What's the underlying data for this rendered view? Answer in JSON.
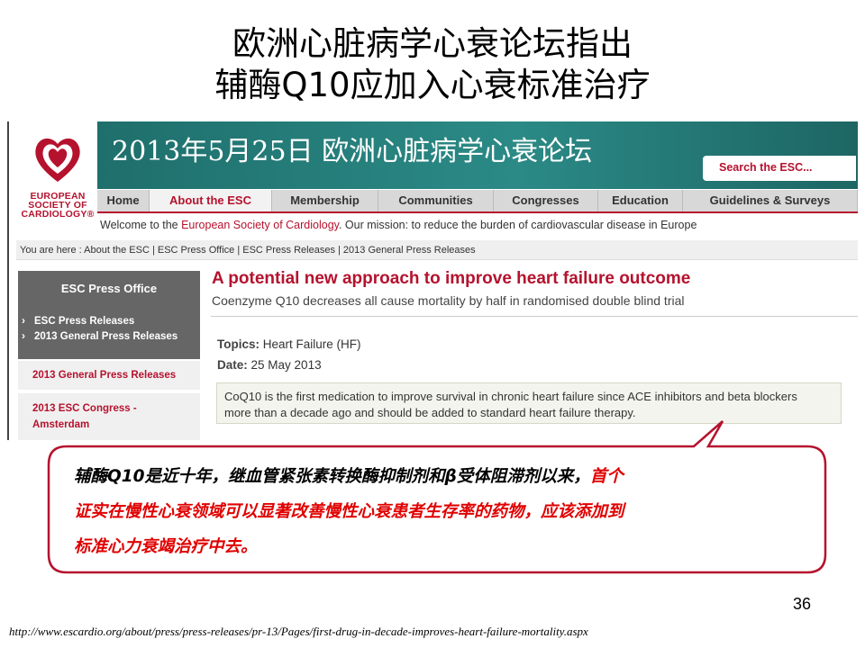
{
  "slide": {
    "title_line1": "欧洲心脏病学心衰论坛指出",
    "title_line2": "辅酶Q10应加入心衰标准治疗",
    "page_number": "36",
    "source_url": "http://www.escardio.org/about/press/press-releases/pr-13/Pages/first-drug-in-decade-improves-heart-failure-mortality.aspx"
  },
  "site": {
    "logo_lines": [
      "EUROPEAN",
      "SOCIETY OF",
      "CARDIOLOGY®"
    ],
    "banner_title": "2013年5月25日  欧洲心脏病学心衰论坛",
    "search_placeholder": "Search the ESC...",
    "nav": [
      {
        "label": "Home",
        "active": false
      },
      {
        "label": "About the ESC",
        "active": true
      },
      {
        "label": "Membership",
        "active": false
      },
      {
        "label": "Communities",
        "active": false
      },
      {
        "label": "Congresses",
        "active": false
      },
      {
        "label": "Education",
        "active": false
      },
      {
        "label": "Guidelines & Surveys",
        "active": false
      }
    ],
    "welcome_prefix": "Welcome to the ",
    "welcome_link": "European Society of Cardiology",
    "welcome_suffix": ". Our mission: to reduce the burden of cardiovascular disease in Europe",
    "breadcrumb": "You are here : About the ESC | ESC Press Office | ESC Press Releases | 2013 General Press Releases"
  },
  "sidebar": {
    "heading": "ESC Press Office",
    "links": [
      "ESC Press Releases",
      "2013 General Press Releases"
    ],
    "row1": "2013 General Press Releases",
    "row2_line1": "2013 ESC Congress -",
    "row2_line2": "Amsterdam"
  },
  "article": {
    "title": "A potential new approach to improve heart failure outcome",
    "subtitle": "Coenzyme Q10 decreases all cause mortality by half in randomised double blind trial",
    "topics_label": "Topics:",
    "topics_value": "Heart Failure (HF)",
    "date_label": "Date:",
    "date_value": "25 May 2013",
    "quote_line1": "CoQ10 is the first medication to improve survival in chronic heart failure since ACE inhibitors and beta blockers",
    "quote_line2": "more than a decade ago and should be added to standard heart failure therapy."
  },
  "callout": {
    "black_part": "辅酶Q10是近十年，继血管紧张素转换酶抑制剂和β受体阻滞剂以来，",
    "red_line1": "首个",
    "red_line2": "证实在慢性心衰领域可以显著改善慢性心衰患者生存率的药物，应该添加到",
    "red_line3": "标准心力衰竭治疗中去。"
  },
  "colors": {
    "esc_red": "#b5122e",
    "banner_teal": "#2b8a86",
    "callout_border": "#b5122e",
    "callout_red_text": "#e00000"
  }
}
